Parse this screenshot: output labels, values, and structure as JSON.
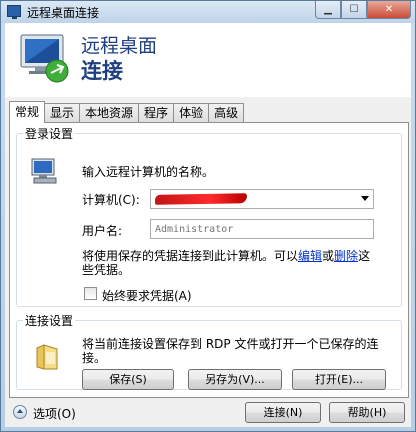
{
  "window": {
    "title": "远程桌面连接"
  },
  "banner": {
    "line1": "远程桌面",
    "line2": "连接"
  },
  "tabs": [
    {
      "label": "常规",
      "active": true
    },
    {
      "label": "显示"
    },
    {
      "label": "本地资源"
    },
    {
      "label": "程序"
    },
    {
      "label": "体验"
    },
    {
      "label": "高级"
    }
  ],
  "logon": {
    "legend": "登录设置",
    "prompt": "输入远程计算机的名称。",
    "computer_label": "计算机(C):",
    "computer_value": "",
    "username_label": "用户名:",
    "username_placeholder": "Administrator",
    "hint_pre": "将使用保存的凭据连接到此计算机。可以",
    "hint_edit": "编辑",
    "hint_or": "或",
    "hint_delete": "删除",
    "hint_post": "这些凭据。",
    "always_ask": "始终要求凭据(A)"
  },
  "conn_settings": {
    "legend": "连接设置",
    "desc": "将当前连接设置保存到 RDP 文件或打开一个已保存的连接。",
    "save": "保存(S)",
    "save_as": "另存为(V)...",
    "open": "打开(E)..."
  },
  "footer": {
    "options": "选项(O)",
    "connect": "连接(N)",
    "help": "帮助(H)"
  },
  "colors": {
    "accent": "#1e3f80",
    "link": "#0033cc",
    "redaction": "#e01b1b"
  }
}
